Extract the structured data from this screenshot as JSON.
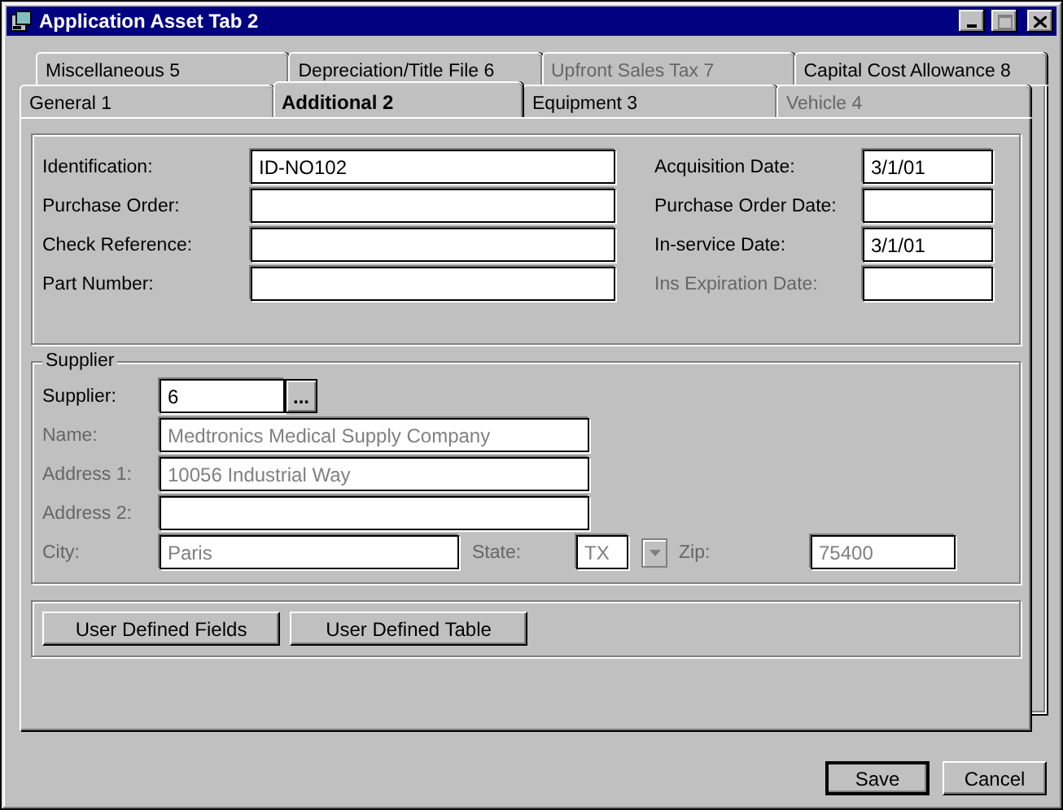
{
  "window": {
    "title": "Application Asset Tab 2"
  },
  "tabs": {
    "back_row": [
      {
        "label": "Miscellaneous 5",
        "disabled": false,
        "selected": false
      },
      {
        "label": "Depreciation/Title File 6",
        "disabled": false,
        "selected": false
      },
      {
        "label": "Upfront Sales Tax 7",
        "disabled": true,
        "selected": false
      },
      {
        "label": "Capital Cost Allowance 8",
        "disabled": false,
        "selected": false
      }
    ],
    "front_row": [
      {
        "label": "General 1",
        "disabled": false,
        "selected": false
      },
      {
        "label": "Additional 2",
        "disabled": false,
        "selected": true
      },
      {
        "label": "Equipment 3",
        "disabled": false,
        "selected": false
      },
      {
        "label": "Vehicle 4",
        "disabled": true,
        "selected": false
      }
    ]
  },
  "details": {
    "rows": [
      {
        "left": {
          "label": "Identification:",
          "value": "ID-NO102",
          "disabled": false
        },
        "right": {
          "label": "Acquisition Date:",
          "value": "3/1/01",
          "disabled": false
        }
      },
      {
        "left": {
          "label": "Purchase Order:",
          "disabled": false
        },
        "right": {
          "label": "Purchase Order Date:",
          "disabled": false
        }
      },
      {
        "left": {
          "label": "Check Reference:",
          "disabled": false
        },
        "right": {
          "label": "In-service Date:",
          "value": "3/1/01",
          "disabled": false
        }
      },
      {
        "left": {
          "label": "Part Number:",
          "disabled": false
        },
        "right": {
          "label": "Ins Expiration Date:",
          "disabled": true
        }
      }
    ]
  },
  "supplier": {
    "title": "Supplier",
    "supplier": {
      "label": "Supplier:",
      "value": "6",
      "disabled": false
    },
    "lookup_button": "...",
    "name": {
      "label": "Name:",
      "value": "Medtronics Medical Supply Company",
      "disabled": true
    },
    "address_1": {
      "label": "Address 1:",
      "value": "10056 Industrial Way",
      "disabled": true
    },
    "address_2": {
      "label": "Address 2:",
      "disabled": true
    },
    "city": {
      "label": "City:",
      "value": "Paris",
      "disabled": true
    },
    "state": {
      "label": "State:",
      "value": "TX",
      "disabled": true
    },
    "zip": {
      "label": "Zip:",
      "value": "75400",
      "disabled": true
    }
  },
  "buttons": [
    {
      "label": "User Defined Fields"
    },
    {
      "label": "User Defined Table"
    }
  ],
  "footer_buttons": [
    {
      "label": "Save",
      "default": true
    },
    {
      "label": "Cancel",
      "default": false
    }
  ]
}
